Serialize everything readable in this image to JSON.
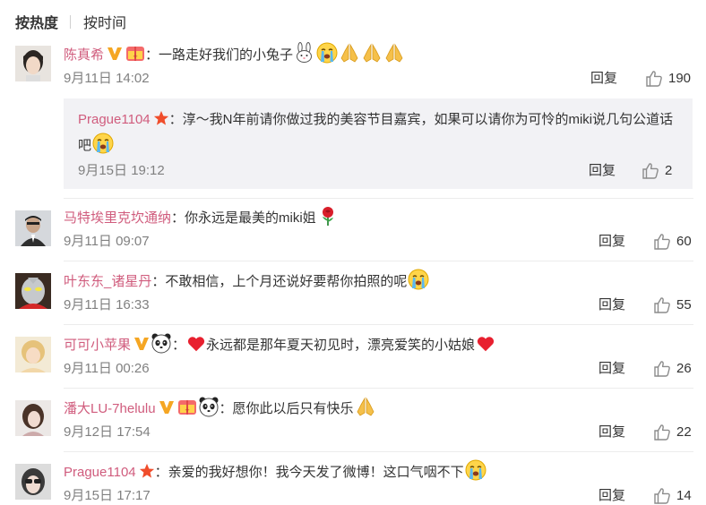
{
  "tabs": {
    "hot": "按热度",
    "time": "按时间"
  },
  "reply_label": "回复",
  "colors": {
    "username": "#d05c7d",
    "meta": "#808080",
    "sub_bg": "#f2f2f5"
  },
  "comments": [
    {
      "user": "陈真希",
      "badges": [
        "vip-v-icon",
        "gift-badge-icon"
      ],
      "text": "：一路走好我们的小兔子",
      "emojis": [
        "rabbit-emoji",
        "crying-face-emoji",
        "pray-hands-emoji",
        "pray-hands-emoji",
        "pray-hands-emoji"
      ],
      "time": "9月11日 14:02",
      "likes": "190",
      "reply": {
        "user": "Prague1104",
        "badges": [
          "star-badge-icon"
        ],
        "text": "：淳～我N年前请你做过我的美容节目嘉宾，如果可以请你为可怜的miki说几句公道话吧",
        "emojis": [
          "crying-face-emoji"
        ],
        "time": "9月15日 19:12",
        "likes": "2"
      }
    },
    {
      "user": "马特埃里克坎通纳",
      "badges": [],
      "text": "：你永远是最美的miki姐",
      "emojis": [
        "rose-emoji"
      ],
      "time": "9月11日 09:07",
      "likes": "60"
    },
    {
      "user": "叶东东_诸星丹",
      "badges": [],
      "text": "：不敢相信，上个月还说好要帮你拍照的呢",
      "emojis": [
        "crying-face-emoji"
      ],
      "time": "9月11日 16:33",
      "likes": "55"
    },
    {
      "user": "可可小苹果",
      "badges": [
        "vip-v-icon",
        "panda-emoji"
      ],
      "pre_emoji": "heart-emoji",
      "text": "：永远都是那年夏天初见时，漂亮爱笑的小姑娘",
      "emojis": [
        "heart-emoji"
      ],
      "time": "9月11日 00:26",
      "likes": "26"
    },
    {
      "user": "潘大LU-7helulu",
      "badges": [
        "vip-v-icon",
        "gift-badge-icon",
        "panda-emoji"
      ],
      "text": "：愿你此以后只有快乐",
      "emojis": [
        "pray-hands-emoji"
      ],
      "time": "9月12日 17:54",
      "likes": "22"
    },
    {
      "user": "Prague1104",
      "badges": [
        "star-badge-icon"
      ],
      "text": "：亲爱的我好想你！我今天发了微博！这口气咽不下",
      "emojis": [
        "crying-face-emoji"
      ],
      "time": "9月15日 17:17",
      "likes": "14"
    }
  ]
}
